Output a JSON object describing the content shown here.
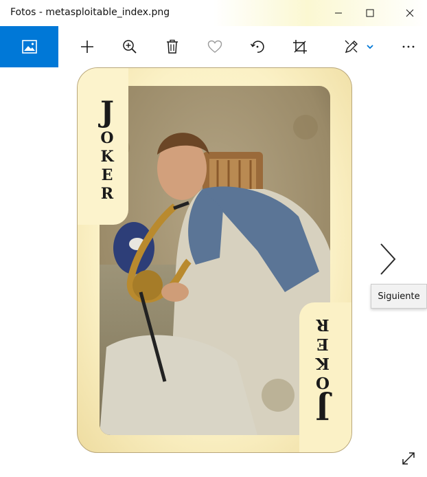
{
  "window": {
    "title": "Fotos - metasploitable_index.png"
  },
  "titlebar_buttons": {
    "minimize": "minimize-icon",
    "maximize": "maximize-icon",
    "close": "close-icon"
  },
  "toolbar": {
    "gallery": "image-gallery-icon",
    "add": "plus-icon",
    "zoom": "zoom-in-icon",
    "delete": "trash-icon",
    "favorite": "heart-icon",
    "rotate": "rotate-icon",
    "crop": "crop-icon",
    "edit": "edit-create-icon",
    "more": "more-icon"
  },
  "image": {
    "card_word_top": "JOKER",
    "card_word_bottom": "JOKER"
  },
  "navigation": {
    "next_icon": "chevron-right-icon",
    "tooltip": "Siguiente"
  },
  "colors": {
    "accent": "#0078d7",
    "card_background": "#fbf1c6",
    "card_text": "#1a1a1a"
  }
}
